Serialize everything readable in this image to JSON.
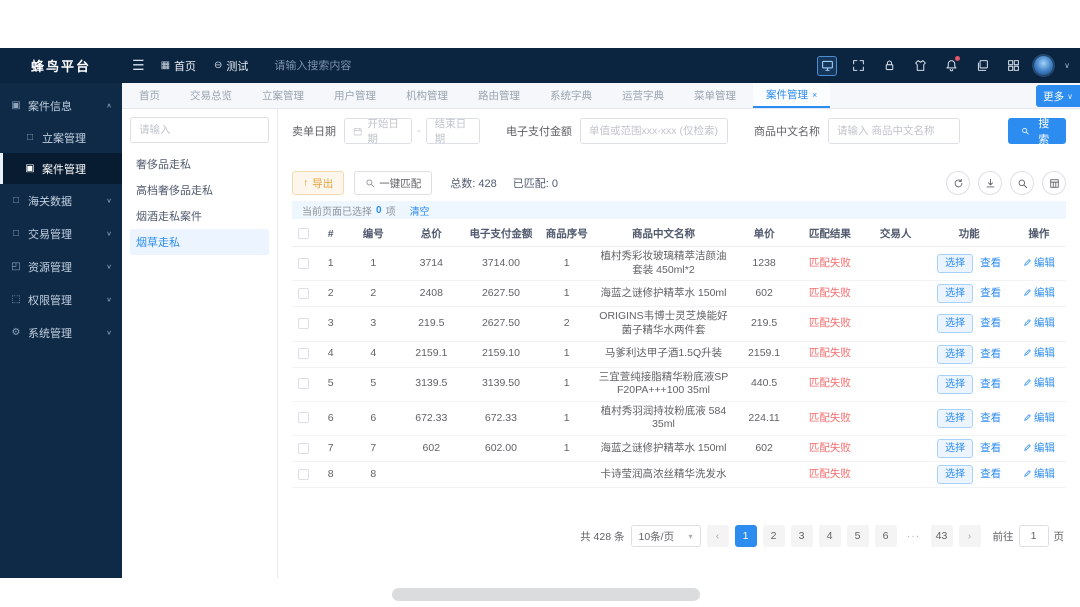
{
  "app": {
    "logo": "蜂鸟平台"
  },
  "header": {
    "icons": {
      "hamburger": "☰",
      "home": "▦",
      "test": "⊖",
      "chevron_down": "∨"
    },
    "menu": [
      {
        "label": "首页"
      },
      {
        "label": "测试"
      }
    ],
    "search_placeholder": "请输入搜索内容"
  },
  "sidebar": {
    "items": [
      {
        "icon": "▣",
        "label": "案件信息",
        "chev": "∧",
        "cls": "group"
      },
      {
        "icon": "□",
        "label": "立案管理",
        "cls": "child"
      },
      {
        "icon": "▣",
        "label": "案件管理",
        "cls": "child",
        "active": true
      },
      {
        "icon": "□",
        "label": "海关数据",
        "chev": "∨",
        "cls": "group"
      },
      {
        "icon": "□",
        "label": "交易管理",
        "chev": "∨",
        "cls": "group"
      },
      {
        "icon": "◰",
        "label": "资源管理",
        "chev": "∨",
        "cls": "group"
      },
      {
        "icon": "⬚",
        "label": "权限管理",
        "chev": "∨",
        "cls": "group"
      },
      {
        "icon": "⚙",
        "label": "系统管理",
        "chev": "∨",
        "cls": "group"
      }
    ]
  },
  "tabs": {
    "items": [
      {
        "label": "首页"
      },
      {
        "label": "交易总览"
      },
      {
        "label": "立案管理"
      },
      {
        "label": "用户管理"
      },
      {
        "label": "机构管理"
      },
      {
        "label": "路由管理"
      },
      {
        "label": "系统字典"
      },
      {
        "label": "运营字典"
      },
      {
        "label": "菜单管理"
      },
      {
        "label": "案件管理",
        "active": true,
        "closable": "×"
      }
    ],
    "more_label": "更多",
    "more_caret": "∨"
  },
  "left_panel": {
    "search_placeholder": "请输入",
    "items": [
      {
        "label": "奢侈品走私"
      },
      {
        "label": "高档奢侈品走私"
      },
      {
        "label": "烟酒走私案件"
      },
      {
        "label": "烟草走私",
        "active": true
      }
    ]
  },
  "filters": {
    "date_label": "卖单日期",
    "date_start_placeholder": "开始日期",
    "date_separator": "-",
    "date_end_placeholder": "结束日期",
    "amount_label": "电子支付金额",
    "amount_placeholder": "单值或范围xxx-xxx (仅检索)",
    "name_label": "商品中文名称",
    "name_placeholder": "请输入 商品中文名称",
    "search_label": "搜索"
  },
  "toolbar": {
    "export_icon": "↑",
    "export_label": "导出",
    "match_label": "一键匹配",
    "total_label": "总数:",
    "total_value": "428",
    "matched_label": "已匹配:",
    "matched_value": "0"
  },
  "selection_bar": {
    "prefix": "当前页面已选择",
    "count": "0",
    "suffix": "项",
    "clear_label": "清空"
  },
  "table": {
    "headers": [
      "#",
      "编号",
      "总价",
      "电子支付金额",
      "商品序号",
      "商品中文名称",
      "单价",
      "匹配结果",
      "交易人",
      "功能",
      "操作"
    ],
    "actions": {
      "select": "选择",
      "view": "查看",
      "edit": "编辑"
    },
    "rows": [
      {
        "idx": "1",
        "num": "1",
        "total": "3714",
        "epay": "3714.00",
        "seq": "1",
        "name": "植村秀彩妆玻璃精萃洁颜油套装 450ml*2",
        "price": "1238",
        "result": "匹配失败",
        "trader": ""
      },
      {
        "idx": "2",
        "num": "2",
        "total": "2408",
        "epay": "2627.50",
        "seq": "1",
        "name": "海蓝之谜修护精萃水 150ml",
        "price": "602",
        "result": "匹配失败",
        "trader": ""
      },
      {
        "idx": "3",
        "num": "3",
        "total": "219.5",
        "epay": "2627.50",
        "seq": "2",
        "name": "ORIGINS韦博士灵芝焕能好菌子精华水两件套",
        "price": "219.5",
        "result": "匹配失败",
        "trader": ""
      },
      {
        "idx": "4",
        "num": "4",
        "total": "2159.1",
        "epay": "2159.10",
        "seq": "1",
        "name": "马爹利达甲子酒1.5Q升装",
        "price": "2159.1",
        "result": "匹配失败",
        "trader": ""
      },
      {
        "idx": "5",
        "num": "5",
        "total": "3139.5",
        "epay": "3139.50",
        "seq": "1",
        "name": "三宜萱纯接脂精华粉底液SPF20PA+++100 35ml",
        "price": "440.5",
        "result": "匹配失败",
        "trader": ""
      },
      {
        "idx": "6",
        "num": "6",
        "total": "672.33",
        "epay": "672.33",
        "seq": "1",
        "name": "植村秀羽润持妆粉底液 584 35ml",
        "price": "224.11",
        "result": "匹配失败",
        "trader": ""
      },
      {
        "idx": "7",
        "num": "7",
        "total": "602",
        "epay": "602.00",
        "seq": "1",
        "name": "海蓝之谜修护精萃水 150ml",
        "price": "602",
        "result": "匹配失败",
        "trader": ""
      },
      {
        "idx": "8",
        "num": "8",
        "total": "",
        "epay": "",
        "seq": "",
        "name": "卡诗莹润高浓丝精华洗发水",
        "price": "",
        "result": "匹配失败",
        "trader": ""
      }
    ]
  },
  "pagination": {
    "total_text": "共 428 条",
    "page_size": "10条/页",
    "caret": "▾",
    "prev": "‹",
    "next": "›",
    "pages": [
      {
        "label": "1",
        "active": true
      },
      {
        "label": "2"
      },
      {
        "label": "3"
      },
      {
        "label": "4"
      },
      {
        "label": "5"
      },
      {
        "label": "6"
      },
      {
        "label": "···",
        "cls": "ellipsis"
      },
      {
        "label": "43"
      }
    ],
    "goto_label": "前往",
    "goto_value": "1",
    "page_unit": "页"
  }
}
